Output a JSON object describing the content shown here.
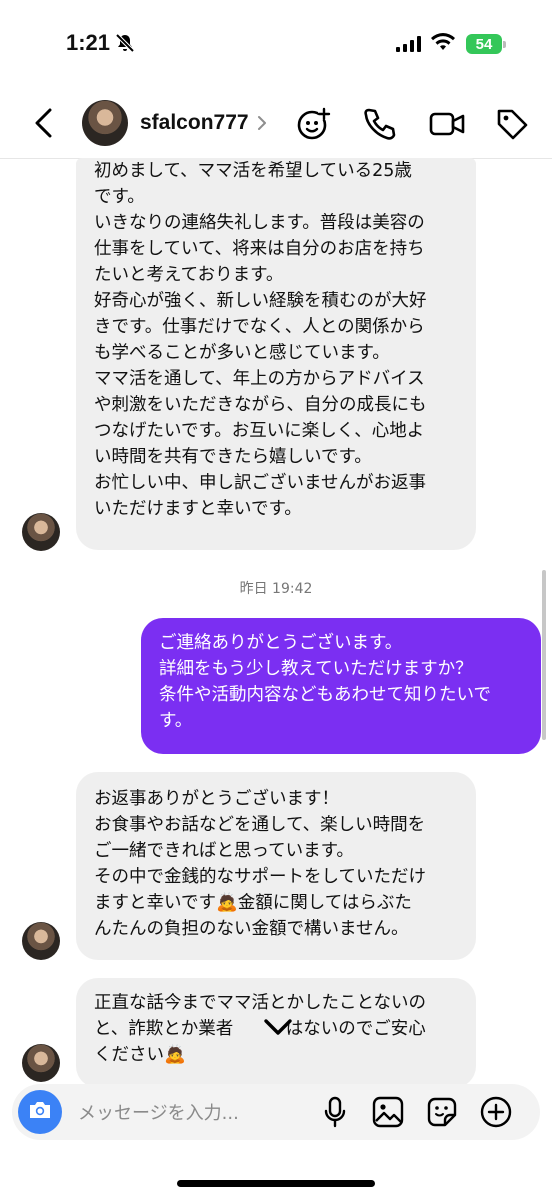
{
  "status_bar": {
    "time": "1:21",
    "battery": "54"
  },
  "header": {
    "username": "sfalcon777"
  },
  "messages": {
    "m1": "初めまして、ママ活を希望している25歳\nです。\nいきなりの連絡失礼します。普段は美容の\n仕事をしていて、将来は自分のお店を持ち\nたいと考えております。\n好奇心が強く、新しい経験を積むのが大好\nきです。仕事だけでなく、人との関係から\nも学べることが多いと感じています。\nママ活を通して、年上の方からアドバイス\nや刺激をいただきながら、自分の成長にも\nつなげたいです。お互いに楽しく、心地よ\nい時間を共有できたら嬉しいです。\nお忙しい中、申し訳ございませんがお返事\nいただけますと幸いです。",
    "timestamp": "昨日 19:42",
    "m2": "ご連絡ありがとうございます。\n詳細をもう少し教えていただけますか？\n条件や活動内容などもあわせて知りたいで\nす。",
    "m3": "お返事ありがとうございます！\nお食事やお話などを通して、楽しい時間を\nご一緒できればと思っています。\nその中で金銭的なサポートをしていただけ\nますと幸いです🙇金額に関してはらぶた\nんたんの負担のない金額で構いません。",
    "m4": "正直な話今までママ活とかしたことないの\nと、詐欺とか業者　　　はないのでご安心\nください🙇"
  },
  "composer": {
    "placeholder": "メッセージを入力..."
  },
  "colors": {
    "outgoing_bubble": "#7b2ff2",
    "incoming_bubble": "#efefef",
    "camera_button": "#3b82f6"
  },
  "icons": [
    "back-icon",
    "chevron-right-icon",
    "effects-icon",
    "phone-icon",
    "video-icon",
    "tag-icon",
    "camera-icon",
    "mic-icon",
    "gallery-icon",
    "sticker-icon",
    "plus-icon",
    "scroll-down-icon"
  ]
}
